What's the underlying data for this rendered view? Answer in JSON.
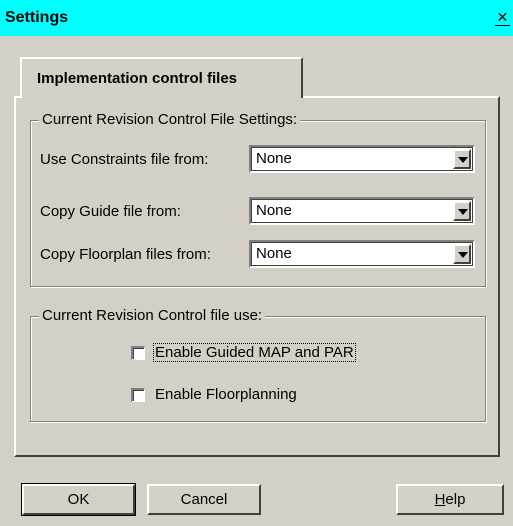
{
  "window": {
    "title": "Settings",
    "close_label": "✕"
  },
  "tab": {
    "label": "Implementation control files"
  },
  "settings_group": {
    "legend": "Current Revision Control File Settings:",
    "rows": [
      {
        "label": "Use Constraints file from:",
        "value": "None"
      },
      {
        "label": "Copy Guide file from:",
        "value": "None"
      },
      {
        "label": "Copy Floorplan files from:",
        "value": "None"
      }
    ]
  },
  "usage_group": {
    "legend": "Current Revision Control file use:",
    "checkboxes": [
      {
        "label": "Enable Guided MAP and PAR",
        "checked": false
      },
      {
        "label": "Enable Floorplanning",
        "checked": false
      }
    ]
  },
  "buttons": {
    "ok": "OK",
    "cancel": "Cancel",
    "help": "Help"
  }
}
